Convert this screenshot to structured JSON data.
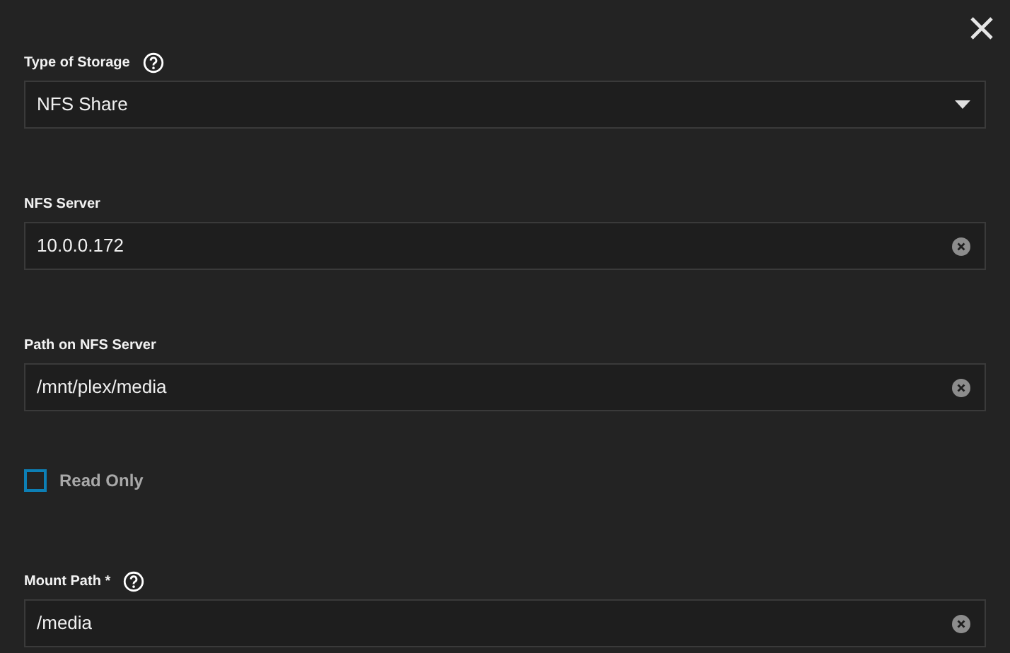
{
  "fields": [
    {
      "kind": "select",
      "label": "Type of Storage",
      "help": true,
      "value": "NFS Share"
    },
    {
      "kind": "text",
      "label": "NFS Server",
      "help": false,
      "value": "10.0.0.172"
    },
    {
      "kind": "text",
      "label": "Path on NFS Server",
      "help": false,
      "value": "/mnt/plex/media"
    },
    {
      "kind": "checkbox",
      "label": "Read Only",
      "checked": false
    },
    {
      "kind": "text",
      "label": "Mount Path *",
      "help": true,
      "value": "/media"
    }
  ]
}
